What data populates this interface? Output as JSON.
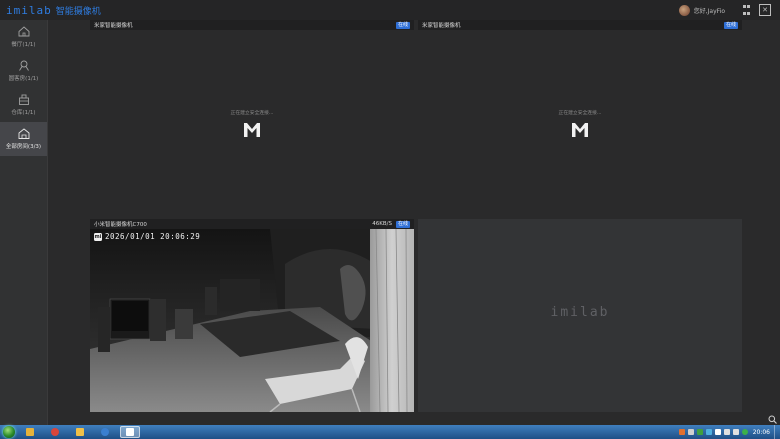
{
  "window": {
    "brand_logo": "imilab",
    "brand_name": "智能摄像机",
    "user_greeting": "您好,JayFio",
    "grid_icon": "grid-icon",
    "close_icon": "close-icon",
    "accent_color": "#2f7de1"
  },
  "sidebar": {
    "items": [
      {
        "label": "餐厅(1/1)",
        "icon": "home-icon",
        "active": false
      },
      {
        "label": "圆客房(1/1)",
        "icon": "room-icon",
        "active": false
      },
      {
        "label": "仓库(1/1)",
        "icon": "warehouse-icon",
        "active": false
      },
      {
        "label": "全部房间(3/3)",
        "icon": "house-icon",
        "active": true
      }
    ]
  },
  "cameras": [
    {
      "name": "米家智能摄像机",
      "status": "在线",
      "message": "正在建立安全连接..."
    },
    {
      "name": "米家智能摄像机",
      "status": "在线",
      "message": "正在建立安全连接..."
    },
    {
      "name": "小米智能摄像机C700",
      "speed": "46KB/S",
      "status": "在线",
      "timestamp": "2026/01/01 20:06:29"
    }
  ],
  "empty_slot": {
    "watermark": "imilab"
  },
  "taskbar": {
    "time": "20:06",
    "apps": [
      {
        "icon": "explorer-icon",
        "color": "#e6b23a"
      },
      {
        "icon": "chrome-icon",
        "color": "#d9453b"
      },
      {
        "icon": "folder-icon",
        "color": "#f0c048"
      },
      {
        "icon": "browser-icon",
        "color": "#3a7fd0"
      },
      {
        "icon": "mihome-icon",
        "color": "#ffffff"
      }
    ],
    "status_online_color": "#2f6fd6"
  }
}
